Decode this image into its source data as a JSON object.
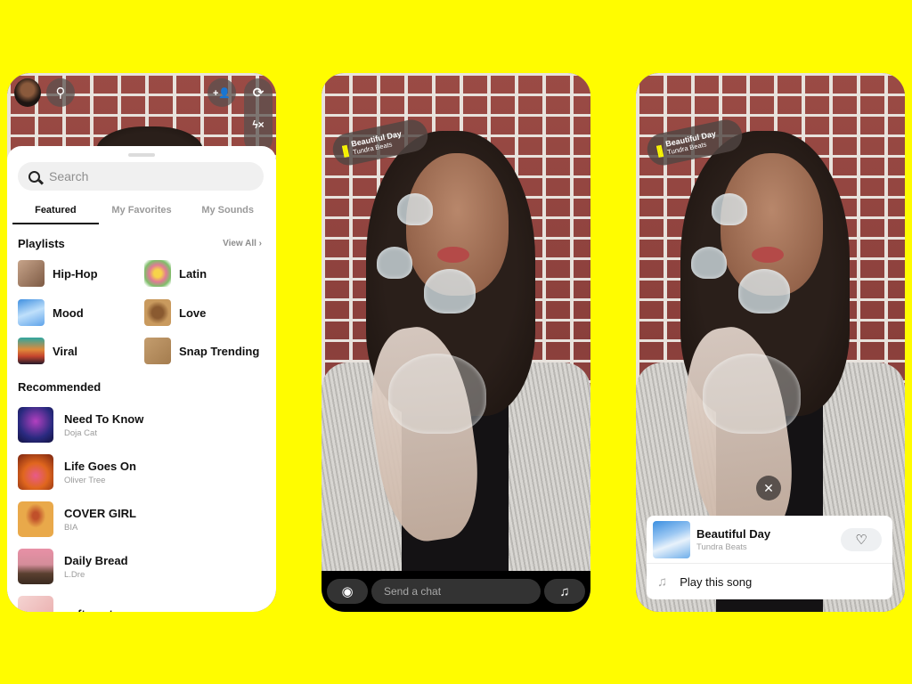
{
  "colors": {
    "background": "#FFFC00",
    "sticker_accent": "#FFFC00"
  },
  "phone1": {
    "top_controls": {
      "avatar": "bitmoji-avatar",
      "search_icon": "search-icon",
      "add_friend_icon": "add-friend-icon",
      "flip_camera_icon": "flip-camera-icon",
      "flash_off_icon": "flash-off-icon"
    },
    "search": {
      "placeholder": "Search"
    },
    "tabs": [
      {
        "label": "Featured",
        "active": true
      },
      {
        "label": "My Favorites",
        "active": false
      },
      {
        "label": "My Sounds",
        "active": false
      }
    ],
    "playlists": {
      "title": "Playlists",
      "view_all": "View All",
      "items": [
        {
          "name": "Hip-Hop",
          "art": "#a68068"
        },
        {
          "name": "Latin",
          "art": "#e07a95"
        },
        {
          "name": "Mood",
          "art": "#6fa9e8"
        },
        {
          "name": "Love",
          "art": "#c48a4e"
        },
        {
          "name": "Viral",
          "art": "#d7683a"
        },
        {
          "name": "Snap Trending",
          "art": "#b48a5c"
        }
      ]
    },
    "recommended": {
      "title": "Recommended",
      "items": [
        {
          "title": "Need To Know",
          "artist": "Doja Cat",
          "art": "#2d2b6e"
        },
        {
          "title": "Life Goes On",
          "artist": "Oliver Tree",
          "art": "#d4541e"
        },
        {
          "title": "COVER GIRL",
          "artist": "BIA",
          "art": "#e9a94a"
        },
        {
          "title": "Daily Bread",
          "artist": "L.Dre",
          "art": "#d48d9a"
        },
        {
          "title": "soft spot",
          "artist": "",
          "art": "#f0c8c8"
        }
      ]
    }
  },
  "phone2": {
    "sticker": {
      "title": "Beautiful Day",
      "artist": "Tundra Beats",
      "icon": "sound-wave-icon"
    },
    "chatbar": {
      "placeholder": "Send a chat",
      "camera_icon": "camera-icon",
      "music_icon": "music-note-icon"
    }
  },
  "phone3": {
    "sticker": {
      "title": "Beautiful Day",
      "artist": "Tundra Beats",
      "icon": "sound-wave-icon"
    },
    "song_card": {
      "title": "Beautiful Day",
      "artist": "Tundra Beats",
      "favorite_icon": "heart-icon",
      "play_label": "Play this song",
      "close_icon": "close-icon"
    }
  },
  "glyphs": {
    "search": "⚲",
    "add_friend": "+👤",
    "flip": "⟳",
    "flash": "ϟ×",
    "camera": "◉",
    "music": "♫",
    "wave": "|||",
    "close": "✕",
    "heart": "♡",
    "note": "♫",
    "chevron": "›"
  }
}
